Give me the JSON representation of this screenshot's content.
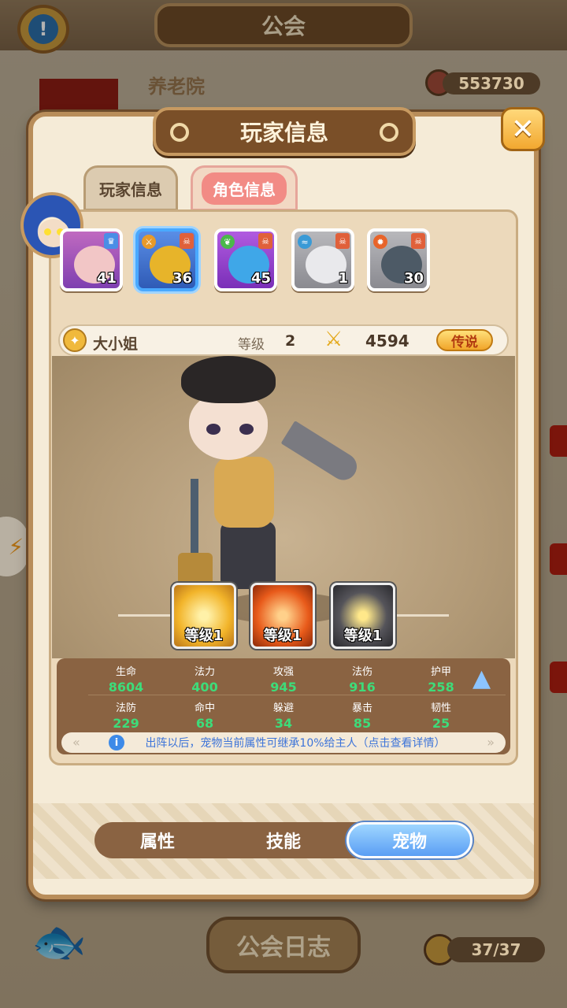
{
  "background": {
    "header_title": "公会",
    "guild_name": "养老院",
    "guild_score": "553730",
    "journal_button": "公会日志",
    "member_count": "37/37"
  },
  "dialog": {
    "title": "玩家信息",
    "close_glyph": "✕",
    "tabs": [
      {
        "label": "玩家信息",
        "active": false
      },
      {
        "label": "角色信息",
        "active": true
      }
    ]
  },
  "pets": [
    {
      "level": "41",
      "selected": false,
      "color": "#d98fb8"
    },
    {
      "level": "36",
      "selected": true,
      "color": "#4e7fd6"
    },
    {
      "level": "45",
      "selected": false,
      "color": "#9a4ed6"
    },
    {
      "level": "1",
      "selected": false,
      "color": "#8e8e96"
    },
    {
      "level": "30",
      "selected": false,
      "color": "#8e8e96"
    }
  ],
  "hero": {
    "name": "大小姐",
    "level_label": "等级",
    "level": "2",
    "power": "4594",
    "rarity": "传说"
  },
  "skills": [
    {
      "level_text": "等级1",
      "color": "#f2b42a"
    },
    {
      "level_text": "等级1",
      "color": "#e85a1a"
    },
    {
      "level_text": "等级1",
      "color": "#55545a"
    }
  ],
  "stats": [
    {
      "label": "生命",
      "value": "8604"
    },
    {
      "label": "法力",
      "value": "400"
    },
    {
      "label": "攻强",
      "value": "945"
    },
    {
      "label": "法伤",
      "value": "916"
    },
    {
      "label": "护甲",
      "value": "258"
    },
    {
      "label": "法防",
      "value": "229"
    },
    {
      "label": "命中",
      "value": "68"
    },
    {
      "label": "躲避",
      "value": "34"
    },
    {
      "label": "暴击",
      "value": "85"
    },
    {
      "label": "韧性",
      "value": "25"
    }
  ],
  "tip": "出阵以后，宠物当前属性可继承10%给主人（点击查看详情）",
  "bottom_tabs": [
    {
      "label": "属性",
      "active": false
    },
    {
      "label": "技能",
      "active": false
    },
    {
      "label": "宠物",
      "active": true
    }
  ],
  "colors": {
    "accent_blue": "#5a9ef4",
    "stat_green": "#3ddc7a",
    "legend_gold": "#f1a52a"
  }
}
